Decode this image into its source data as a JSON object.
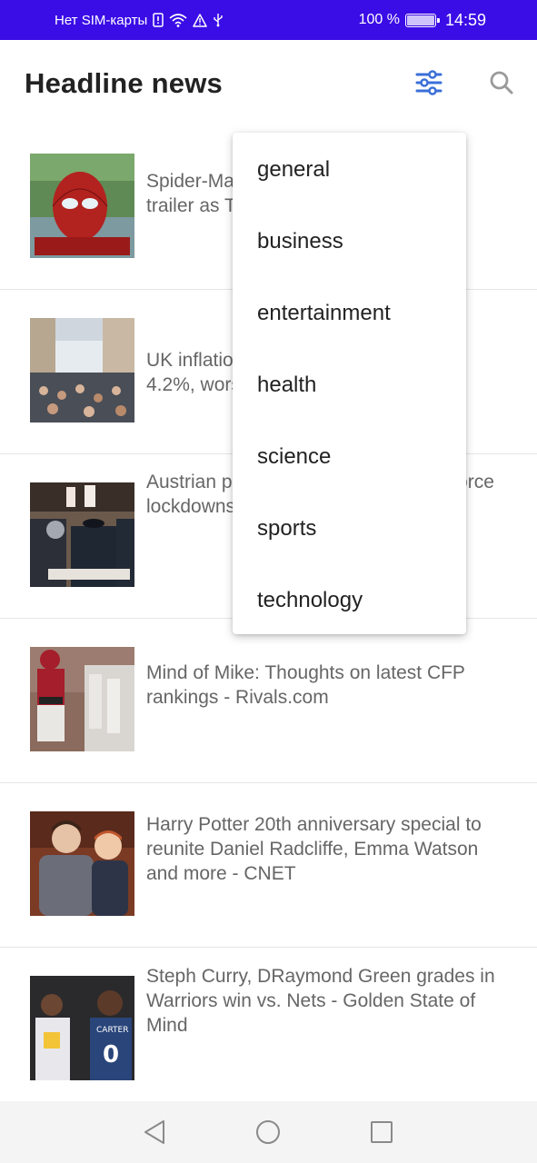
{
  "status_bar": {
    "carrier": "Нет SIM-карты",
    "battery_percent": "100 %",
    "battery_level": 1.0,
    "time": "14:59",
    "icons": [
      "sim-alert-icon",
      "wifi-icon",
      "warning-icon",
      "usb-icon",
      "battery-icon"
    ]
  },
  "app_bar": {
    "title": "Headline news",
    "accent_color": "#3a6fd8",
    "icons": [
      "filter-sliders-icon",
      "search-icon"
    ]
  },
  "articles": [
    {
      "title": "Spider-Man: No Way Home released trailer as Tobey Maguire returns - The"
    },
    {
      "title": "UK inflation rises to a 10-year high of 4.2%, worse than expected"
    },
    {
      "title": "Austrian police step up checks to enforce lockdowns for the unvaccinated"
    },
    {
      "title": "Mind of Mike: Thoughts on latest CFP rankings - Rivals.com"
    },
    {
      "title": "Harry Potter 20th anniversary special to reunite Daniel Radcliffe, Emma Watson and more - CNET"
    },
    {
      "title": "Steph Curry, DRaymond Green grades in Warriors win vs. Nets - Golden State of Mind"
    }
  ],
  "category_menu": {
    "items": [
      "general",
      "business",
      "entertainment",
      "health",
      "science",
      "sports",
      "technology"
    ]
  },
  "nav_bar": {
    "icons": [
      "back-triangle-icon",
      "home-circle-icon",
      "recents-square-icon"
    ]
  },
  "colors": {
    "status_bar": "#3a0ce6",
    "title_text": "#222222",
    "article_text": "#666666",
    "divider": "#e6e6e6"
  }
}
